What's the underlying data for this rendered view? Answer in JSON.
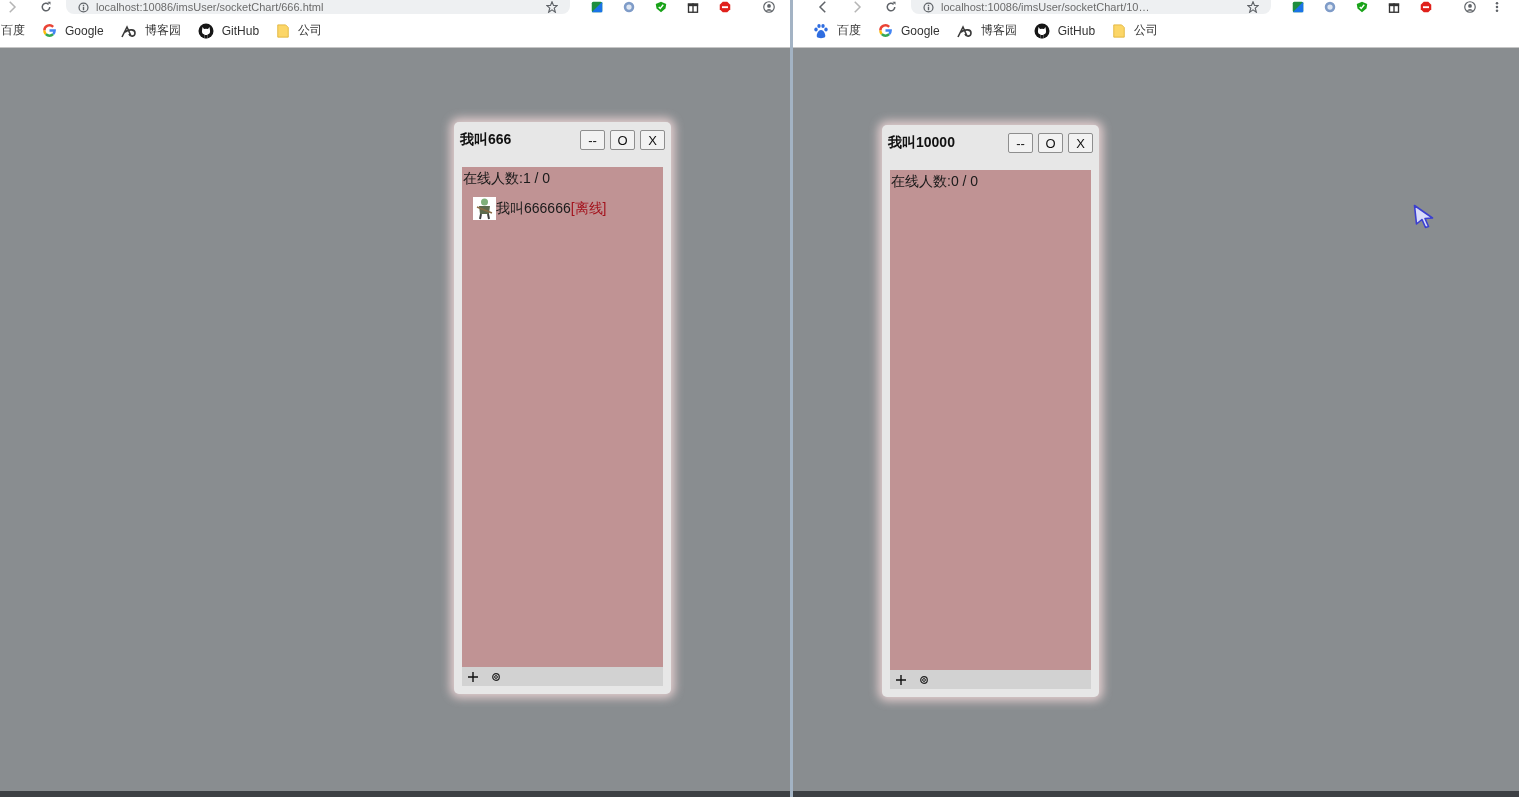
{
  "browsers": [
    {
      "address": "localhost:10086/imsUser/socketChart/666.html",
      "bookmarks": [
        {
          "kind": "plain",
          "label": "百度"
        },
        {
          "kind": "google",
          "label": "Google"
        },
        {
          "kind": "swirl",
          "label": "博客园"
        },
        {
          "kind": "cat",
          "label": "GitHub"
        },
        {
          "kind": "folder",
          "label": "公司"
        }
      ],
      "chat": {
        "title": "我叫666",
        "buttons": [
          "--",
          "O",
          "X"
        ],
        "online": "在线人数:1 / 0",
        "users": [
          {
            "name": "我叫666666",
            "status": "[离线]",
            "online": false
          }
        ]
      }
    },
    {
      "address": "localhost:10086/imsUser/socketChart/10…",
      "cursor": true,
      "bookmarks": [
        {
          "kind": "paw",
          "label": "百度"
        },
        {
          "kind": "google",
          "label": "Google"
        },
        {
          "kind": "swirl",
          "label": "博客园"
        },
        {
          "kind": "cat",
          "label": "GitHub"
        },
        {
          "kind": "folder",
          "label": "公司"
        }
      ],
      "chat": {
        "title": "我叫10000",
        "buttons": [
          "--",
          "O",
          "X"
        ],
        "online": "在线人数:0 / 0"
      }
    }
  ]
}
